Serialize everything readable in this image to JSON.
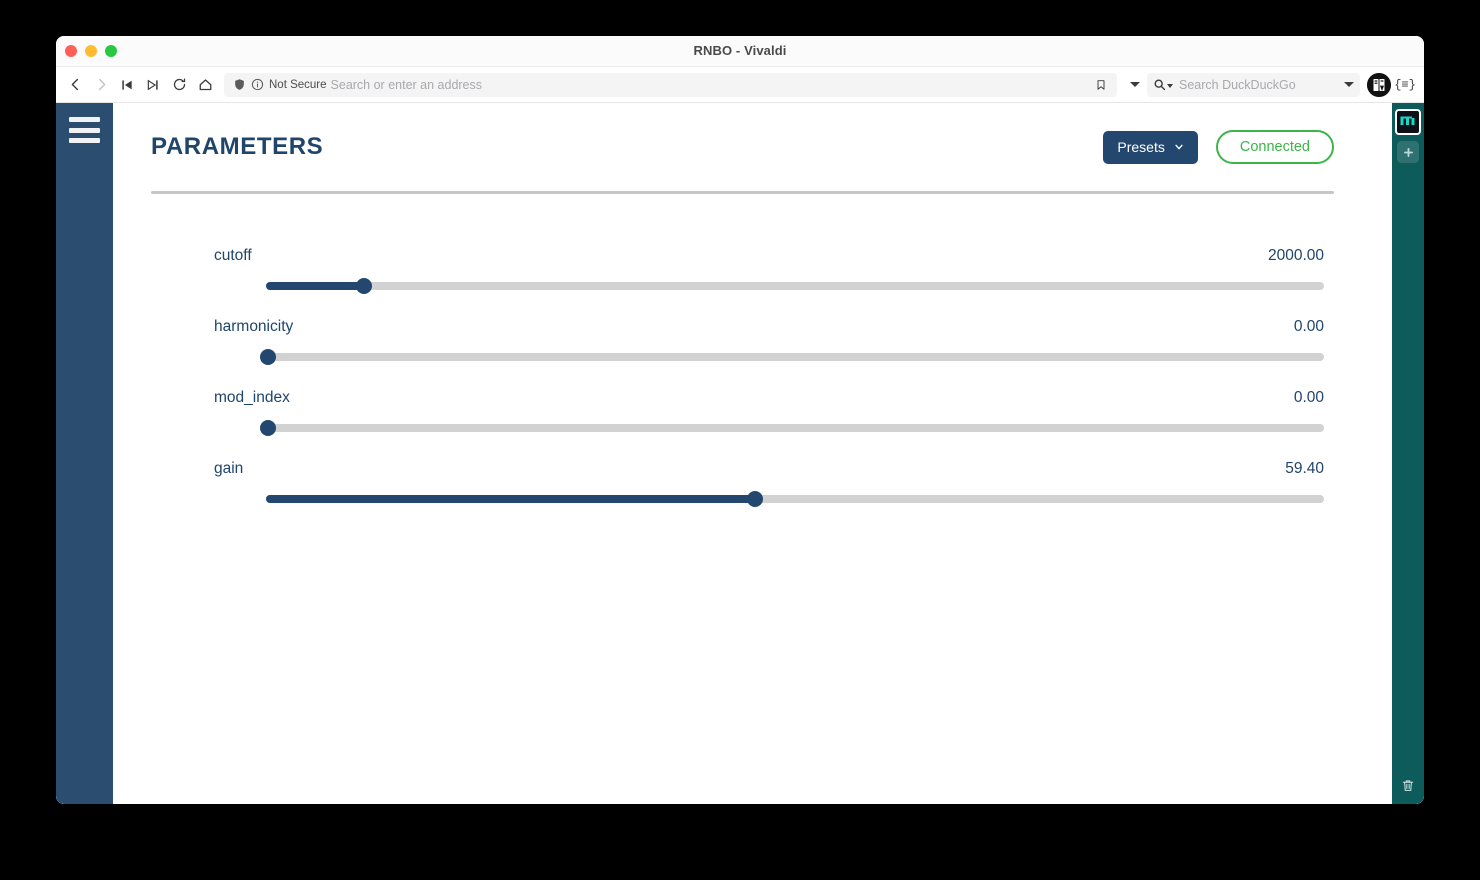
{
  "window": {
    "title": "RNBO - Vivaldi",
    "traffic_lights": [
      "close",
      "minimize",
      "zoom"
    ]
  },
  "toolbar": {
    "back_icon": "chevron-left-icon",
    "forward_icon": "chevron-right-icon",
    "rewind_icon": "skip-to-start-icon",
    "fast_forward_icon": "skip-to-end-icon",
    "reload_icon": "reload-icon",
    "home_icon": "home-icon",
    "shield_icon": "shield-icon",
    "info_icon": "info-circle-icon",
    "security_label": "Not Secure",
    "address_value": "",
    "address_placeholder": "Search or enter an address",
    "bookmark_icon": "bookmark-icon",
    "bookmark_caret_icon": "chevron-down-icon",
    "search_icon": "search-icon",
    "search_value": "",
    "search_placeholder": "Search DuckDuckGo",
    "search_caret_icon": "chevron-down-icon",
    "avatar_icon": "profile-avatar-icon",
    "panel_toggle_label": "{≡}"
  },
  "app_sidebar": {
    "menu_icon": "hamburger-menu-icon"
  },
  "page": {
    "title": "PARAMETERS",
    "presets_label": "Presets",
    "presets_caret_icon": "chevron-down-icon",
    "connection_status": "Connected",
    "accent_navy": "#23476e",
    "accent_green": "#3bb54a",
    "track_gray": "#d2d2d2"
  },
  "parameters": [
    {
      "name": "cutoff",
      "value": "2000.00",
      "percent": 9.3
    },
    {
      "name": "harmonicity",
      "value": "0.00",
      "percent": 0.2
    },
    {
      "name": "mod_index",
      "value": "0.00",
      "percent": 0.2
    },
    {
      "name": "gain",
      "value": "59.40",
      "percent": 46.2
    }
  ],
  "extension_panel": {
    "active_extension_icon": "extension-icon",
    "add_icon": "plus-icon",
    "trash_icon": "trash-icon"
  }
}
